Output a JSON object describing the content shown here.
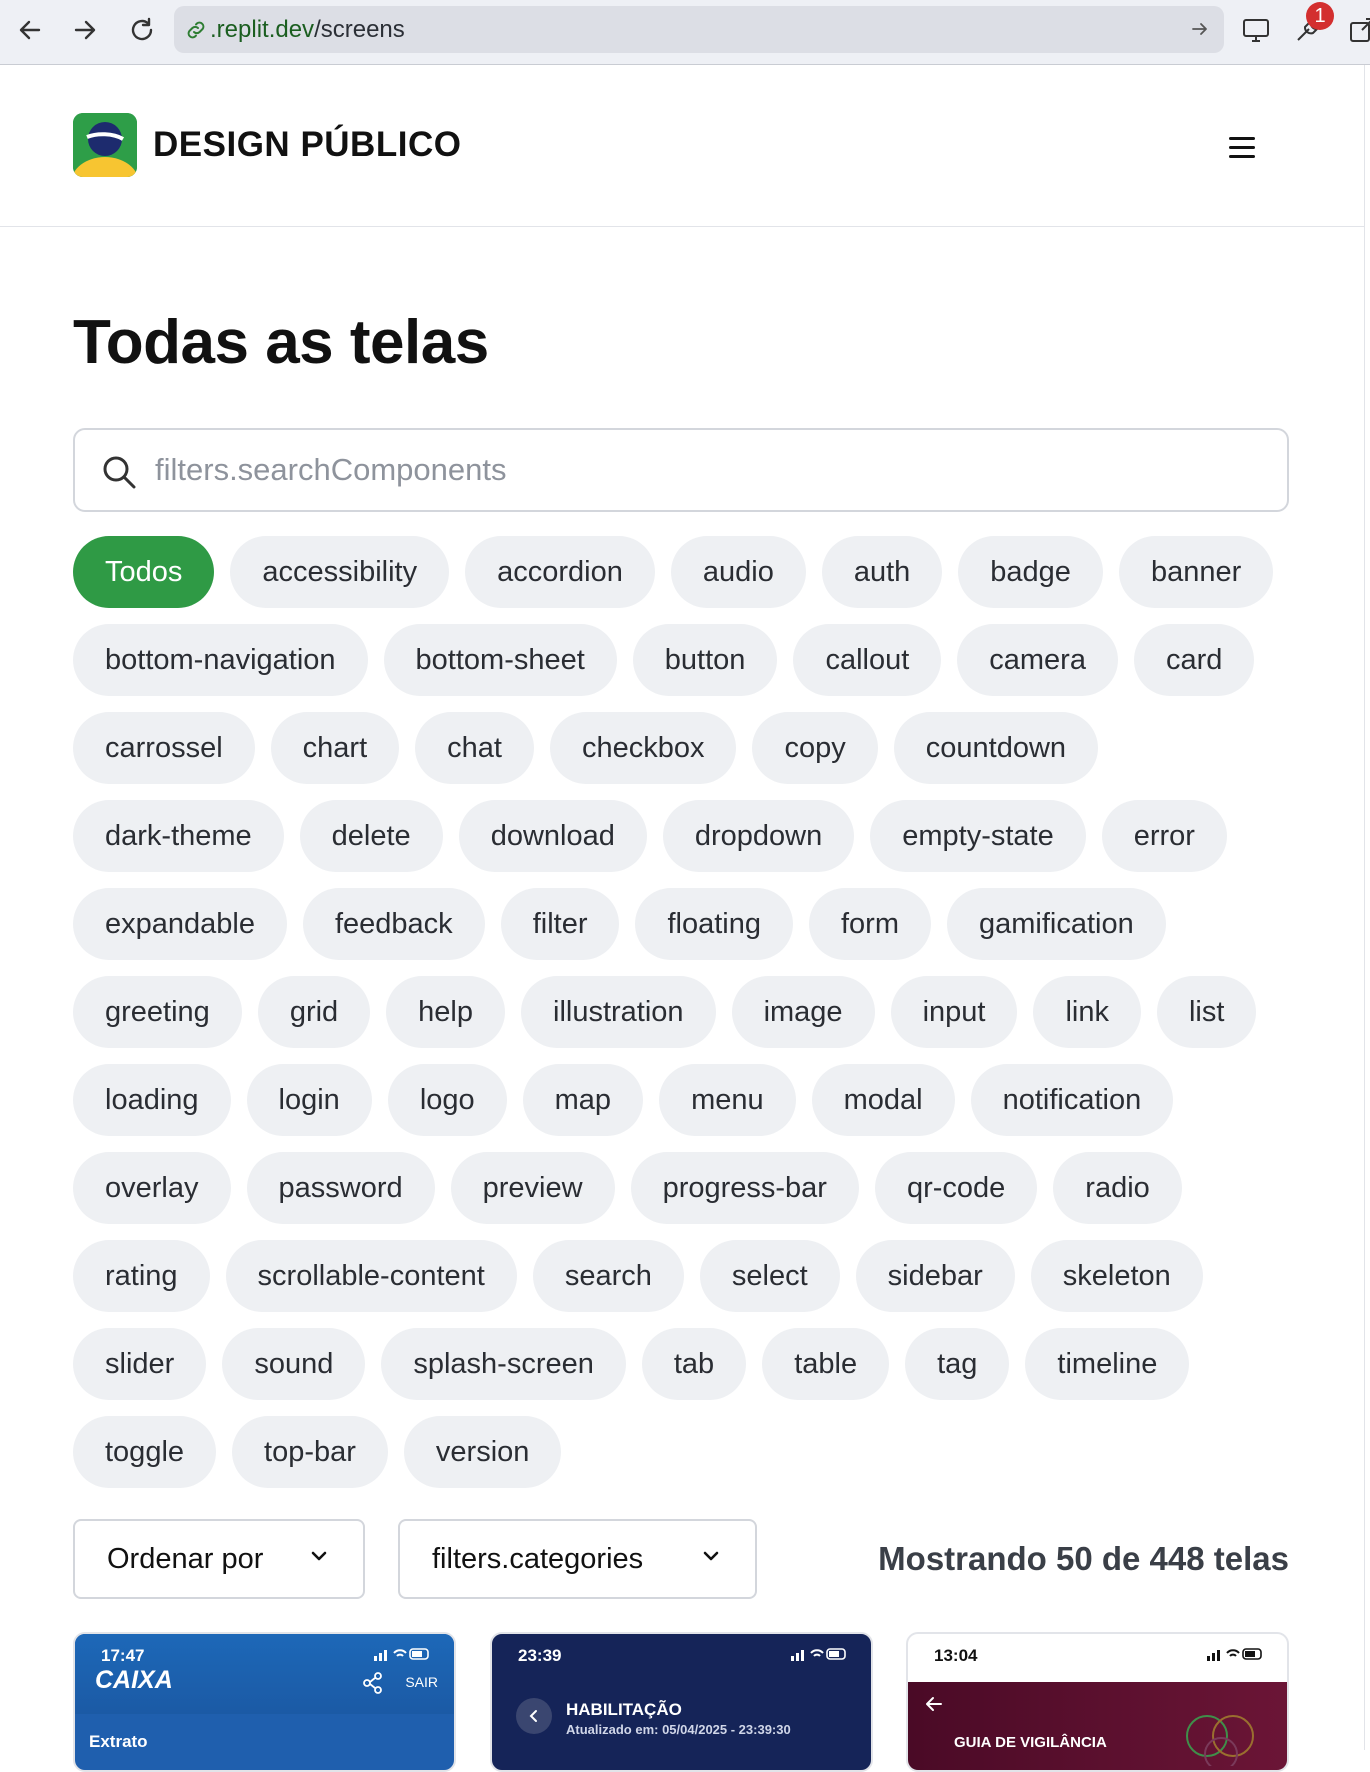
{
  "browser": {
    "url_host": ".replit.dev",
    "url_path": "/screens",
    "notification_count": "1"
  },
  "header": {
    "logo_bold": "DESIGN",
    "logo_rest": "PÚBLICO"
  },
  "main": {
    "title": "Todas as telas",
    "search_placeholder": "filters.searchComponents",
    "tags": [
      "Todos",
      "accessibility",
      "accordion",
      "audio",
      "auth",
      "badge",
      "banner",
      "bottom-navigation",
      "bottom-sheet",
      "button",
      "callout",
      "camera",
      "card",
      "carrossel",
      "chart",
      "chat",
      "checkbox",
      "copy",
      "countdown",
      "dark-theme",
      "delete",
      "download",
      "dropdown",
      "empty-state",
      "error",
      "expandable",
      "feedback",
      "filter",
      "floating",
      "form",
      "gamification",
      "greeting",
      "grid",
      "help",
      "illustration",
      "image",
      "input",
      "link",
      "list",
      "loading",
      "login",
      "logo",
      "map",
      "menu",
      "modal",
      "notification",
      "overlay",
      "password",
      "preview",
      "progress-bar",
      "qr-code",
      "radio",
      "rating",
      "scrollable-content",
      "search",
      "select",
      "sidebar",
      "skeleton",
      "slider",
      "sound",
      "splash-screen",
      "tab",
      "table",
      "tag",
      "timeline",
      "toggle",
      "top-bar",
      "version"
    ],
    "active_tag": "Todos",
    "sort_label": "Ordenar por",
    "categories_label": "filters.categories",
    "result_text": "Mostrando 50 de 448 telas"
  },
  "cards": [
    {
      "time": "17:47",
      "brand": "CAIXA",
      "action": "SAIR",
      "section": "Extrato"
    },
    {
      "time": "23:39",
      "title": "HABILITAÇÃO",
      "subtitle": "Atualizado em: 05/04/2025 - 23:39:30"
    },
    {
      "time": "13:04",
      "title": "GUIA DE VIGILÂNCIA"
    }
  ],
  "colors": {
    "accent_green": "#2f9a45",
    "chip_bg": "#eef0f3"
  }
}
